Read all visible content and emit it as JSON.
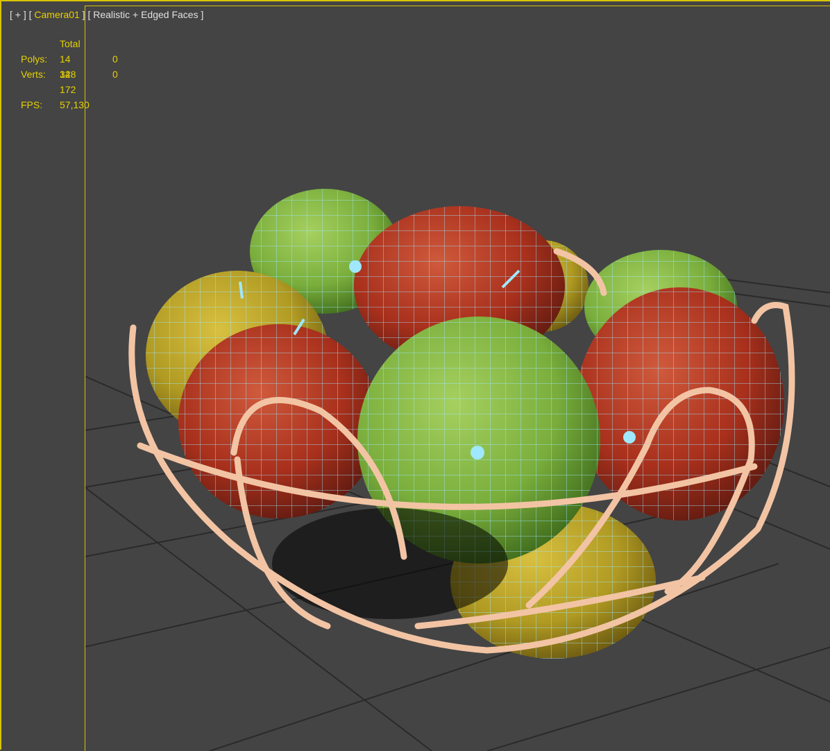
{
  "viewport": {
    "menu_label": "[ + ]",
    "camera_label": "Camera01",
    "shading_label": "[ Realistic + Edged Faces ]"
  },
  "stats": {
    "header": "Total",
    "polys_label": "Polys:",
    "polys_total": "14 328",
    "polys_selected": "0",
    "verts_label": "Verts:",
    "verts_total": "14 172",
    "verts_selected": "0",
    "fps_label": "FPS:",
    "fps_value": "57,130"
  },
  "colors": {
    "background": "#444444",
    "grid": "#2a2a2a",
    "frame": "#d8c400",
    "stats_text": "#e6d200",
    "wire": "#9fe8ff",
    "basket": "#f2c4a4"
  }
}
